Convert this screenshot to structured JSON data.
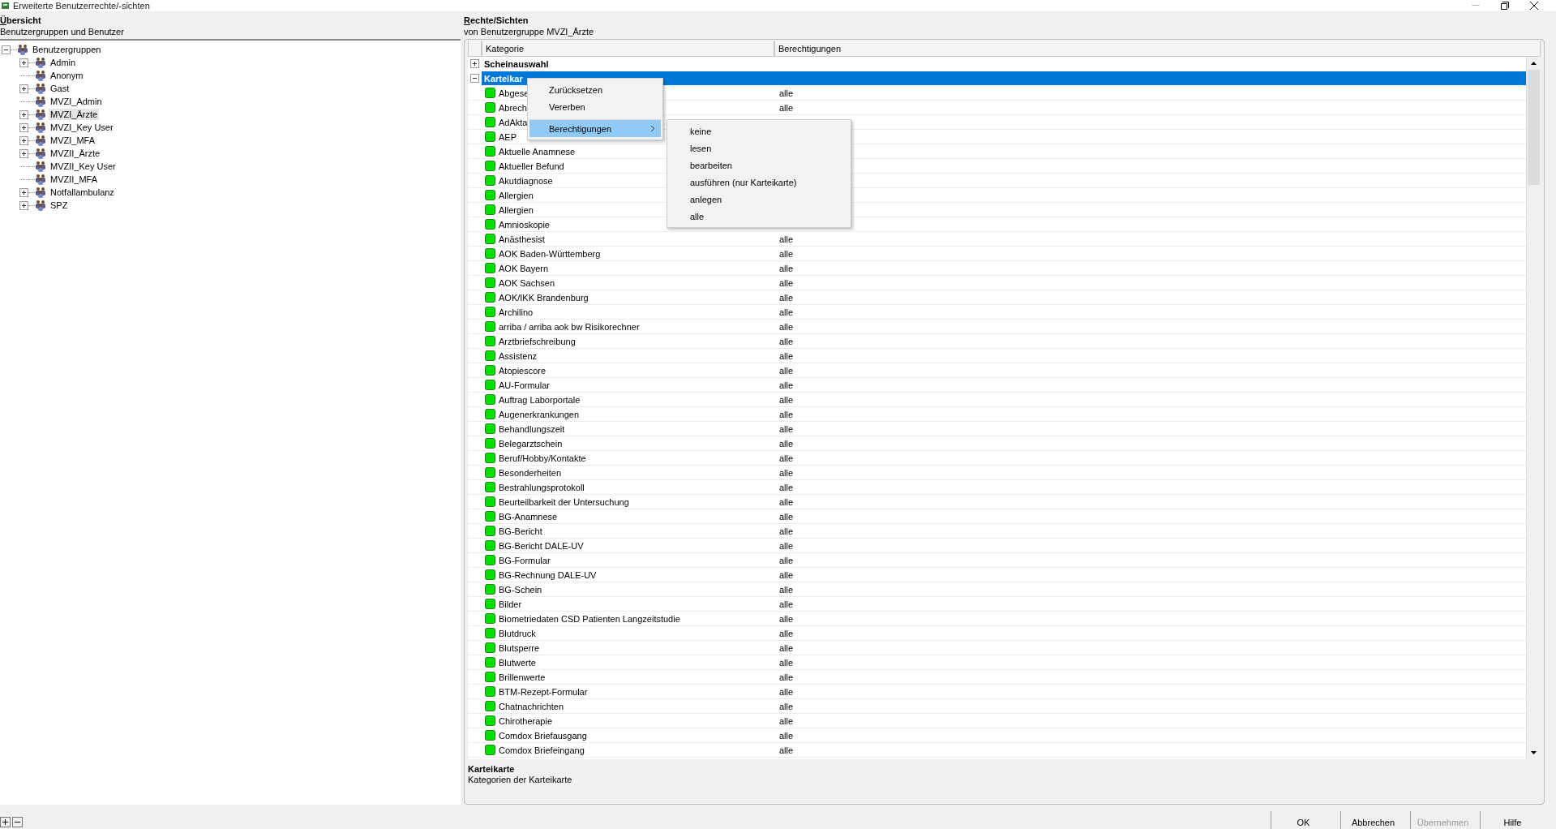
{
  "window": {
    "title": "Erweiterte Benutzerrechte/-sichten"
  },
  "overview": {
    "title": "Übersicht",
    "subtitle": "Benutzergruppen und Benutzer",
    "tree": [
      {
        "label": "Benutzergruppen",
        "expandable": true,
        "expanded": true,
        "selected": false,
        "children": [
          {
            "label": "Admin",
            "expandable": true,
            "selected": false
          },
          {
            "label": "Anonym",
            "expandable": false,
            "selected": false
          },
          {
            "label": "Gast",
            "expandable": true,
            "selected": false
          },
          {
            "label": "MVZI_Admin",
            "expandable": false,
            "selected": false
          },
          {
            "label": "MVZI_Ärzte",
            "expandable": true,
            "selected": true
          },
          {
            "label": "MVZI_Key User",
            "expandable": true,
            "selected": false
          },
          {
            "label": "MVZI_MFA",
            "expandable": true,
            "selected": false
          },
          {
            "label": "MVZII_Ärzte",
            "expandable": true,
            "selected": false
          },
          {
            "label": "MVZII_Key User",
            "expandable": false,
            "selected": false
          },
          {
            "label": "MVZII_MFA",
            "expandable": false,
            "selected": false
          },
          {
            "label": "Notfallambulanz",
            "expandable": true,
            "selected": false
          },
          {
            "label": "SPZ",
            "expandable": true,
            "selected": false
          }
        ]
      }
    ]
  },
  "rights": {
    "title": "Rechte/Sichten",
    "subtitle": "von Benutzergruppe MVZI_Ärzte",
    "columns": [
      "Kategorie",
      "Berechtigungen"
    ],
    "groups": [
      {
        "label": "Scheinauswahl",
        "expanded": false,
        "selected": false
      },
      {
        "label": "Karteikar",
        "expanded": true,
        "selected": true,
        "items": [
          {
            "name": "Abgese",
            "permission": "alle"
          },
          {
            "name": "Abrech",
            "permission": "alle"
          },
          {
            "name": "AdAkta"
          },
          {
            "name": "AEP"
          },
          {
            "name": "Aktuelle Anamnese"
          },
          {
            "name": "Aktueller Befund"
          },
          {
            "name": "Akutdiagnose"
          },
          {
            "name": "Allergien"
          },
          {
            "name": "Allergien"
          },
          {
            "name": "Amnioskopie"
          },
          {
            "name": "Anästhesist",
            "permission": "alle"
          },
          {
            "name": "AOK Baden-Württemberg",
            "permission": "alle"
          },
          {
            "name": "AOK Bayern",
            "permission": "alle"
          },
          {
            "name": "AOK Sachsen",
            "permission": "alle"
          },
          {
            "name": "AOK/IKK Brandenburg",
            "permission": "alle"
          },
          {
            "name": "Archilino",
            "permission": "alle"
          },
          {
            "name": "arriba / arriba aok bw Risikorechner",
            "permission": "alle"
          },
          {
            "name": "Arztbriefschreibung",
            "permission": "alle"
          },
          {
            "name": "Assistenz",
            "permission": "alle"
          },
          {
            "name": "Atopiescore",
            "permission": "alle"
          },
          {
            "name": "AU-Formular",
            "permission": "alle"
          },
          {
            "name": "Auftrag Laborportale",
            "permission": "alle"
          },
          {
            "name": "Augenerkrankungen",
            "permission": "alle"
          },
          {
            "name": "Behandlungszeit",
            "permission": "alle"
          },
          {
            "name": "Belegarztschein",
            "permission": "alle"
          },
          {
            "name": "Beruf/Hobby/Kontakte",
            "permission": "alle"
          },
          {
            "name": "Besonderheiten",
            "permission": "alle"
          },
          {
            "name": "Bestrahlungsprotokoll",
            "permission": "alle"
          },
          {
            "name": "Beurteilbarkeit der Untersuchung",
            "permission": "alle"
          },
          {
            "name": "BG-Anamnese",
            "permission": "alle"
          },
          {
            "name": "BG-Bericht",
            "permission": "alle"
          },
          {
            "name": "BG-Bericht DALE-UV",
            "permission": "alle"
          },
          {
            "name": "BG-Formular",
            "permission": "alle"
          },
          {
            "name": "BG-Rechnung DALE-UV",
            "permission": "alle"
          },
          {
            "name": "BG-Schein",
            "permission": "alle"
          },
          {
            "name": "Bilder",
            "permission": "alle"
          },
          {
            "name": "Biometriedaten CSD Patienten Langzeitstudie",
            "permission": "alle"
          },
          {
            "name": "Blutdruck",
            "permission": "alle"
          },
          {
            "name": "Blutsperre",
            "permission": "alle"
          },
          {
            "name": "Blutwerte",
            "permission": "alle"
          },
          {
            "name": "Brillenwerte",
            "permission": "alle"
          },
          {
            "name": "BTM-Rezept-Formular",
            "permission": "alle"
          },
          {
            "name": "Chatnachrichten",
            "permission": "alle"
          },
          {
            "name": "Chirotherapie",
            "permission": "alle"
          },
          {
            "name": "Comdox Briefausgang",
            "permission": "alle"
          },
          {
            "name": "Comdox Briefeingang",
            "permission": "alle"
          }
        ]
      }
    ],
    "description": {
      "title": "Karteikarte",
      "text": "Kategorien der Karteikarte"
    }
  },
  "context_menu": {
    "items": [
      {
        "label": "Zurücksetzen",
        "selected": false,
        "separator_before": false
      },
      {
        "label": "Vererben",
        "selected": false,
        "separator_before": false
      },
      {
        "label": "Berechtigungen",
        "selected": true,
        "separator_before": true,
        "submenu": [
          {
            "label": "keine",
            "selected": false
          },
          {
            "label": "lesen",
            "selected": false
          },
          {
            "label": "bearbeiten",
            "selected": false
          },
          {
            "label": "ausführen (nur Karteikarte)",
            "selected": false
          },
          {
            "label": "anlegen",
            "selected": false
          },
          {
            "label": "alle",
            "selected": false
          }
        ]
      }
    ]
  },
  "buttons": [
    {
      "label": "OK",
      "disabled": false
    },
    {
      "label": "Abbrechen",
      "disabled": false
    },
    {
      "label": "Übernehmen",
      "disabled": true
    },
    {
      "label": "Hilfe",
      "disabled": false
    }
  ]
}
